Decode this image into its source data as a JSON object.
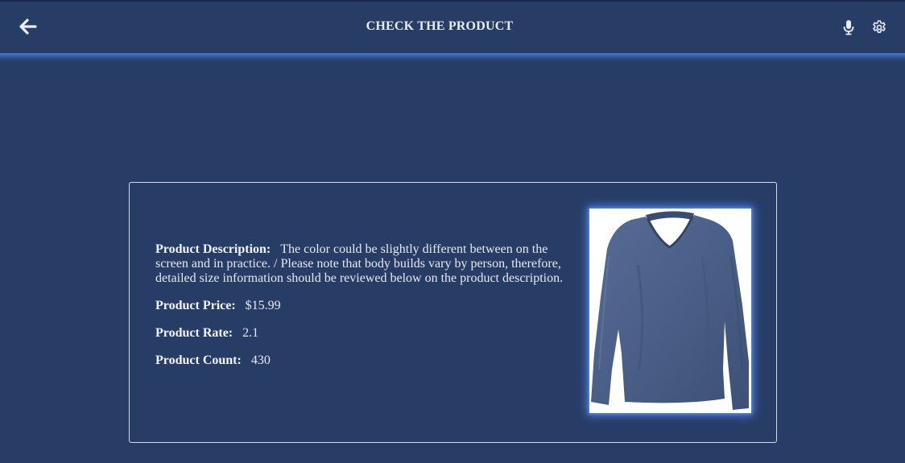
{
  "header": {
    "title": "CHECK THE PRODUCT",
    "back_icon": "arrow-left-icon",
    "mic_icon": "microphone-icon",
    "settings_icon": "gear-icon"
  },
  "product": {
    "description_label": "Product Description:",
    "description": "The color could be slightly different between on the screen and in practice. / Please note that body builds vary by person, therefore, detailed size information should be reviewed below on the product description.",
    "price_label": "Product Price:",
    "price": "$15.99",
    "rate_label": "Product Rate:",
    "rate": "2.1",
    "count_label": "Product Count:",
    "count": "430",
    "image_icon": "long-sleeve-shirt-image"
  },
  "colors": {
    "background": "#283d66",
    "header_glow": "#4d79d1",
    "card_border": "#d7dcea",
    "shirt": "#4a5f87"
  }
}
